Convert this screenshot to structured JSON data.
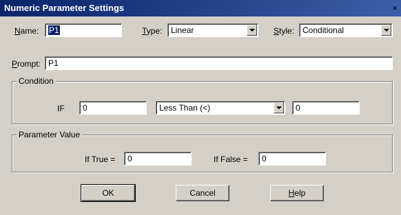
{
  "window": {
    "title": "Numeric Parameter Settings",
    "close_glyph": "×"
  },
  "name": {
    "label_prefix": "",
    "label_hotkey": "N",
    "label_rest": "ame:",
    "value": "P1"
  },
  "type": {
    "label_hotkey": "T",
    "label_rest": "ype:",
    "value": "Linear"
  },
  "style": {
    "label_hotkey": "S",
    "label_rest": "tyle:",
    "value": "Conditional"
  },
  "prompt": {
    "label_hotkey": "P",
    "label_rest": "rompt:",
    "value": "P1"
  },
  "condition": {
    "group_title": "Condition",
    "if_label": "IF",
    "left_value": "0",
    "operator": "Less Than (<)",
    "right_value": "0"
  },
  "parameter_value": {
    "group_title": "Parameter Value",
    "if_true_label": "If True =",
    "if_true_value": "0",
    "if_false_label": "If False =",
    "if_false_value": "0"
  },
  "buttons": {
    "ok": "OK",
    "cancel": "Cancel",
    "help_hotkey": "H",
    "help_rest": "elp"
  },
  "icons": {
    "close": "close-icon",
    "dropdown": "chevron-down-icon"
  },
  "colors": {
    "title_bar": "#0a246a",
    "dialog_bg": "#d4d0c8",
    "selection": "#0a246a"
  }
}
